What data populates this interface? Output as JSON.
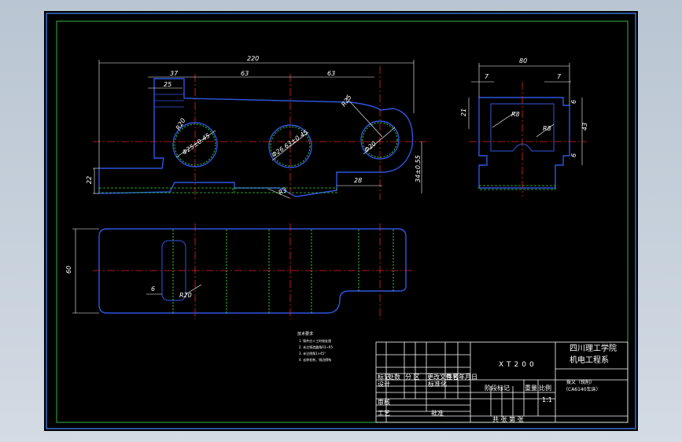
{
  "drawing": {
    "part_number": "XT200",
    "school": {
      "line1": "四川理工学院",
      "line2": "机电工程系"
    },
    "part_name": {
      "line1": "拨叉（铣削）",
      "line2": "（CA6140车床）"
    },
    "scale": "1:1",
    "sheet_label": "共    张    第    张",
    "title_block": {
      "mark": "标记",
      "count": "处数",
      "zone": "分    区",
      "change_doc": "更改文件号",
      "signature": "签名",
      "date": "年月日",
      "design": "设计",
      "standardize": "标准化",
      "stage_mark": "阶段标记",
      "weight": "重量",
      "ratio": "比例",
      "review": "审核",
      "process": "工艺",
      "approve": "批准"
    },
    "tech_notes": {
      "title": "技术要求",
      "lines": [
        "1. 铸件应人工时效处理",
        "2. 未注铸造圆角R3~R5",
        "3. 未注倒角1×45°",
        "4. 去除毛刺，锐边倒钝"
      ]
    },
    "dimensions": {
      "d220": "220",
      "d37": "37",
      "d63a": "63",
      "d63b": "63",
      "d25": "25",
      "r20": "R20",
      "bore1": "Φ25±0.45",
      "bore2": "Φ26.63±0.45",
      "bore3": "Φ20",
      "r25": "R25",
      "d28": "28",
      "d22": "22",
      "d34": "34±0.55",
      "r3": "R3",
      "d80": "80",
      "d7a": "7",
      "d7b": "7",
      "d6a": "6",
      "d6b": "6",
      "d6c": "6",
      "d21": "21",
      "d43": "43",
      "r8a": "R8",
      "r8b": "R8",
      "d60": "60",
      "d6": "6",
      "r20b": "R20"
    }
  }
}
